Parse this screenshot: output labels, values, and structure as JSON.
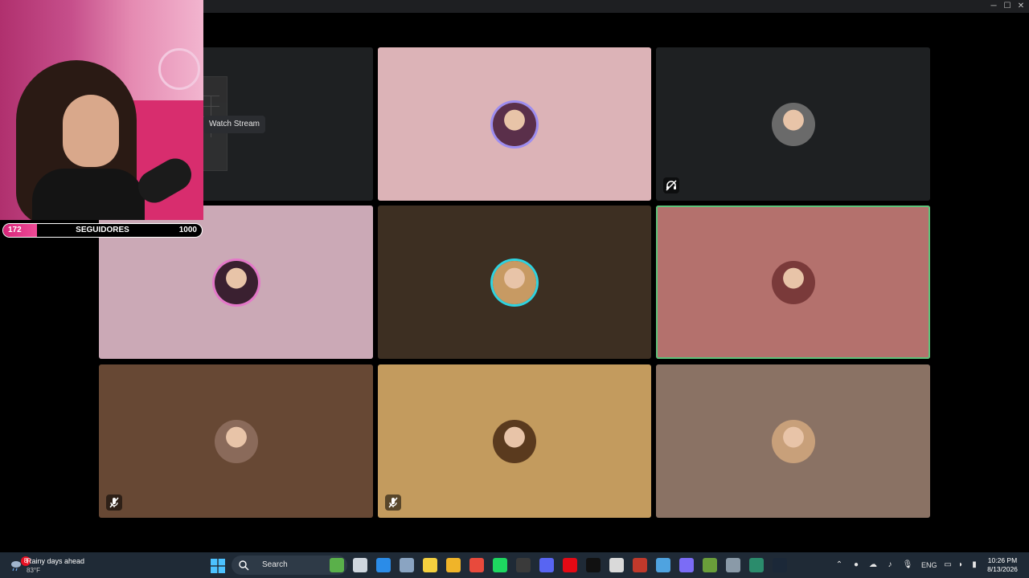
{
  "call": {
    "stream_tile": {
      "watch_label": "Watch Stream",
      "bg": "#1e2022"
    },
    "participants": [
      {
        "id": "p2",
        "bg": "#dcb3b7",
        "avatar": "#5a2f4a",
        "ring": "#9c8cf0",
        "muted": false,
        "deafened": false,
        "speaking": false
      },
      {
        "id": "p3",
        "bg": "#1e2022",
        "avatar": "#6a6a6a",
        "ring": "",
        "muted": false,
        "deafened": true,
        "speaking": false
      },
      {
        "id": "p4",
        "bg": "#cba9b6",
        "avatar": "#3a2030",
        "ring": "#e377c8",
        "muted": false,
        "deafened": false,
        "speaking": false
      },
      {
        "id": "p5",
        "bg": "#3d2f22",
        "avatar": "#c79a63",
        "ring": "#2fd3e0",
        "muted": false,
        "deafened": false,
        "speaking": false
      },
      {
        "id": "p6",
        "bg": "#b4716d",
        "avatar": "#7a3a3a",
        "ring": "",
        "muted": false,
        "deafened": false,
        "speaking": true
      },
      {
        "id": "p7",
        "bg": "#674834",
        "avatar": "#8a6a5a",
        "ring": "",
        "muted": true,
        "deafened": false,
        "speaking": false
      },
      {
        "id": "p8",
        "bg": "#c39b5e",
        "avatar": "#5a3a1e",
        "ring": "",
        "muted": true,
        "deafened": false,
        "speaking": false
      },
      {
        "id": "p9",
        "bg": "#8a7264",
        "avatar": "#c8a07a",
        "ring": "",
        "muted": false,
        "deafened": false,
        "speaking": false
      }
    ]
  },
  "overlay": {
    "followers_current": "172",
    "followers_label": "SEGUIDORES",
    "followers_goal": "1000",
    "progress_fraction": 0.172
  },
  "taskbar": {
    "weather_title": "Rainy days ahead",
    "weather_temp": "83°F",
    "weather_badge": "8",
    "search_label": "Search",
    "language": "ENG",
    "time": "10:26 PM",
    "date": "8/13/2026",
    "apps": [
      {
        "name": "sticker-app-icon",
        "color": "#5ab04a"
      },
      {
        "name": "task-view-icon",
        "color": "#cfd6de"
      },
      {
        "name": "store-icon",
        "color": "#2b8ce8"
      },
      {
        "name": "settings-icon",
        "color": "#8aa4c2"
      },
      {
        "name": "notes-icon",
        "color": "#f4d03f"
      },
      {
        "name": "file-explorer-icon",
        "color": "#f0b429"
      },
      {
        "name": "chrome-icon",
        "color": "#e84a3c"
      },
      {
        "name": "spotify-icon",
        "color": "#1ed760"
      },
      {
        "name": "obs-icon",
        "color": "#3a3a3a"
      },
      {
        "name": "discord-icon",
        "color": "#5865f2"
      },
      {
        "name": "netflix-icon",
        "color": "#e50914"
      },
      {
        "name": "tiktok-icon",
        "color": "#111111"
      },
      {
        "name": "capture-icon",
        "color": "#d9d9d9"
      },
      {
        "name": "voicemod-icon",
        "color": "#c0392b"
      },
      {
        "name": "photos-icon",
        "color": "#4fa3e0"
      },
      {
        "name": "controller-icon",
        "color": "#7b6cf6"
      },
      {
        "name": "minecraft-icon",
        "color": "#6a9e3a"
      },
      {
        "name": "calculator-icon",
        "color": "#8a9aa8"
      },
      {
        "name": "terminal-icon",
        "color": "#2b8c6c"
      },
      {
        "name": "steam-icon",
        "color": "#1b2838"
      }
    ]
  }
}
